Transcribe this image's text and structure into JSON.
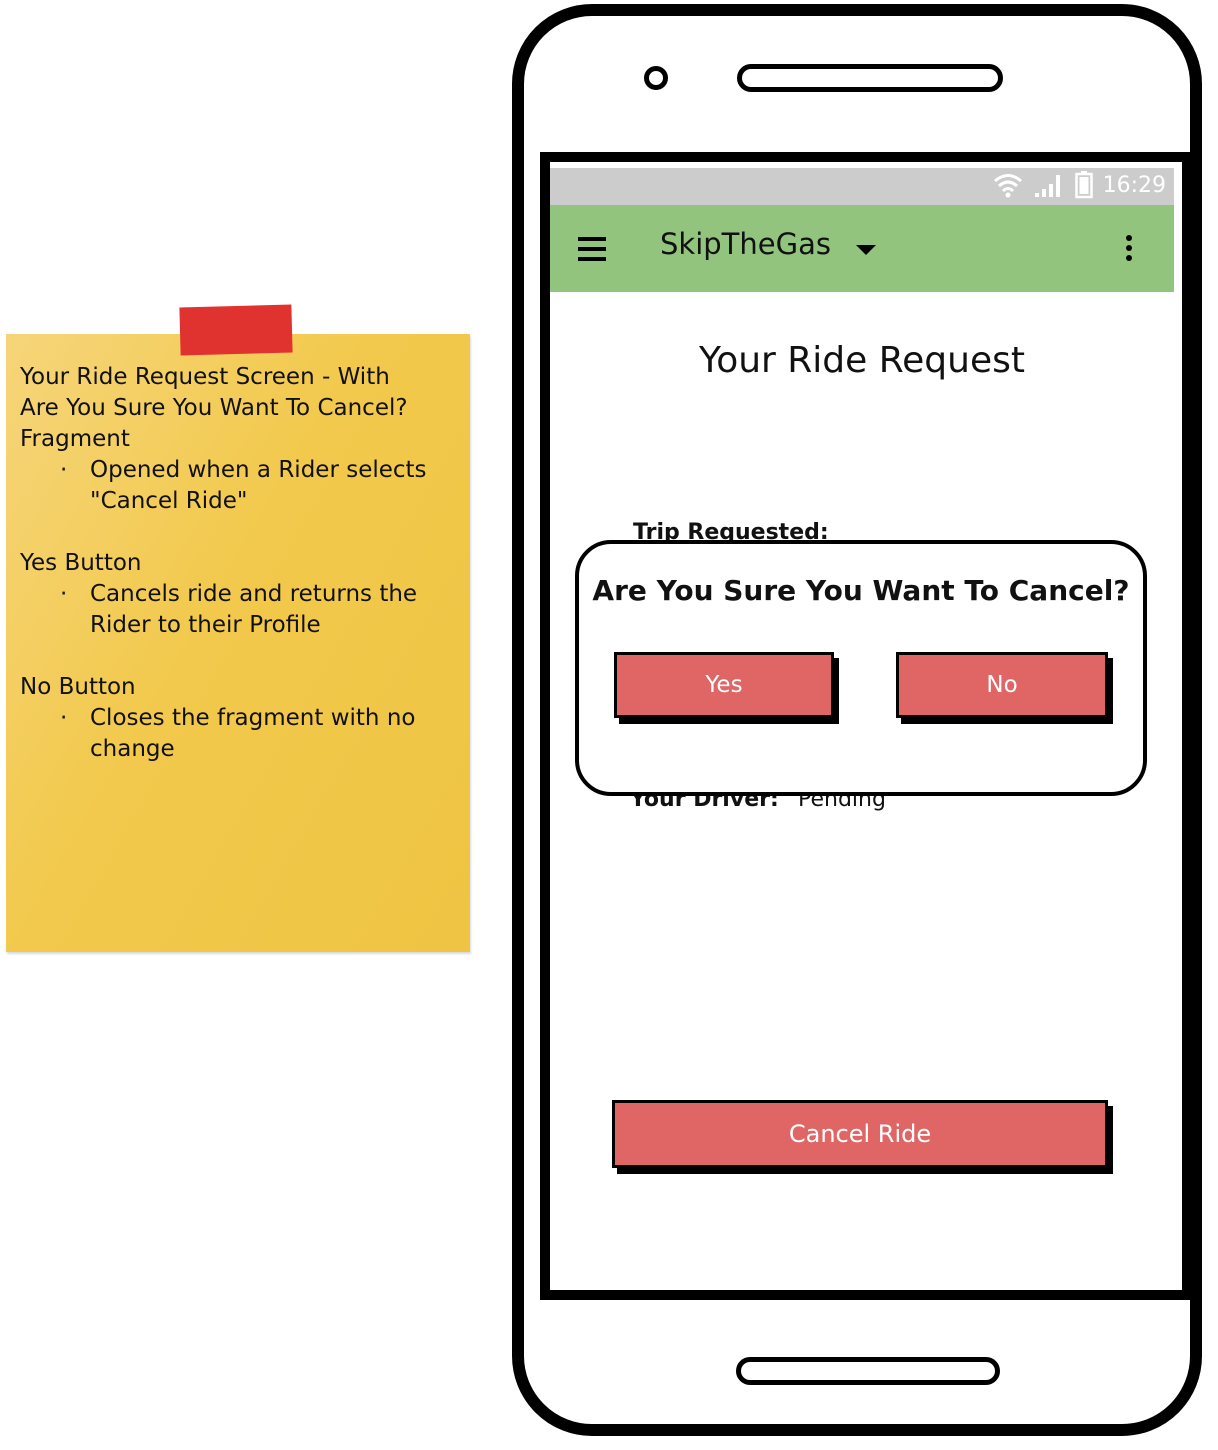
{
  "note": {
    "title_line1": "Your Ride Request Screen - With",
    "title_line2": "Are You Sure You Want To Cancel?",
    "title_line3": "Fragment",
    "bullet1_line1": "Opened when a Rider selects",
    "bullet1_line2": "\"Cancel Ride\"",
    "yes_heading": "Yes Button",
    "bullet2_line1": "Cancels ride and returns the",
    "bullet2_line2": "Rider to their Profile",
    "no_heading": "No Button",
    "bullet3_line1": "Closes the fragment with no",
    "bullet3_line2": "change",
    "color": "#f2c94c",
    "tape_color": "#e0322e"
  },
  "statusbar": {
    "time": "16:29",
    "icons": [
      "wifi-icon",
      "signal-icon",
      "battery-icon"
    ]
  },
  "appbar": {
    "title": "SkipTheGas",
    "color": "#93c47d",
    "icons": [
      "hamburger-menu-icon",
      "dropdown-caret-icon",
      "overflow-menu-icon"
    ]
  },
  "screen": {
    "page_title": "Your Ride Request",
    "trip_label": "Trip Requested:",
    "driver_label": "Your Driver:",
    "driver_value": "Pending",
    "cancel_label": "Cancel Ride"
  },
  "dialog": {
    "title": "Are You Sure You Want To Cancel?",
    "yes_label": "Yes",
    "no_label": "No"
  },
  "colors": {
    "button": "#e06666",
    "statusbar": "#cccccc"
  }
}
